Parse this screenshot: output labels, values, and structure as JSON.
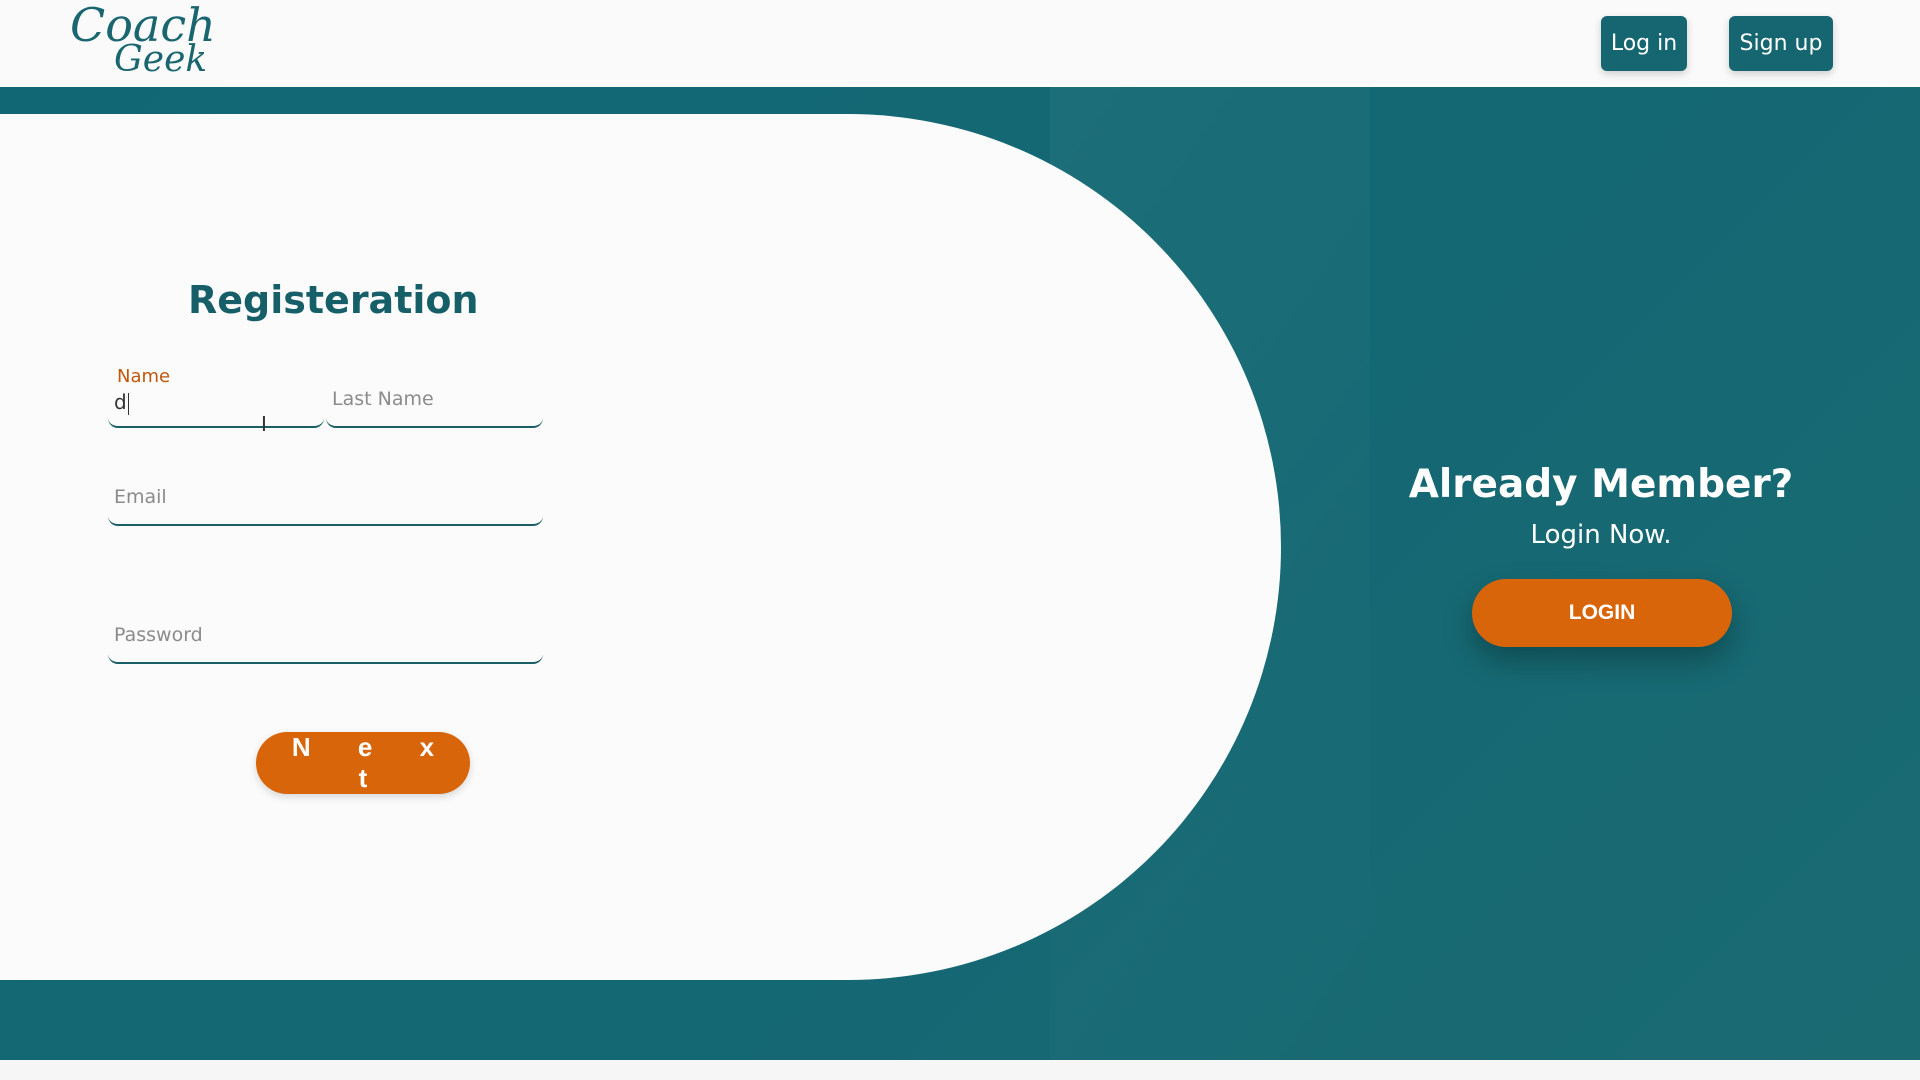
{
  "header": {
    "logo_line1": "Coach",
    "logo_line2": "Geek",
    "login_label": "Log in",
    "signup_label": "Sign up"
  },
  "form": {
    "title": "Registeration",
    "name": {
      "label": "Name",
      "value": "d"
    },
    "last_name": {
      "placeholder": "Last Name"
    },
    "email": {
      "placeholder": "Email"
    },
    "password": {
      "placeholder": "Password"
    },
    "next_label": "N e x t"
  },
  "side": {
    "title": "Already Member?",
    "subtitle": "Login Now.",
    "login_label": "LOGIN"
  },
  "colors": {
    "teal": "#156670",
    "orange": "#d9650a",
    "floating_label": "#c2570c"
  }
}
